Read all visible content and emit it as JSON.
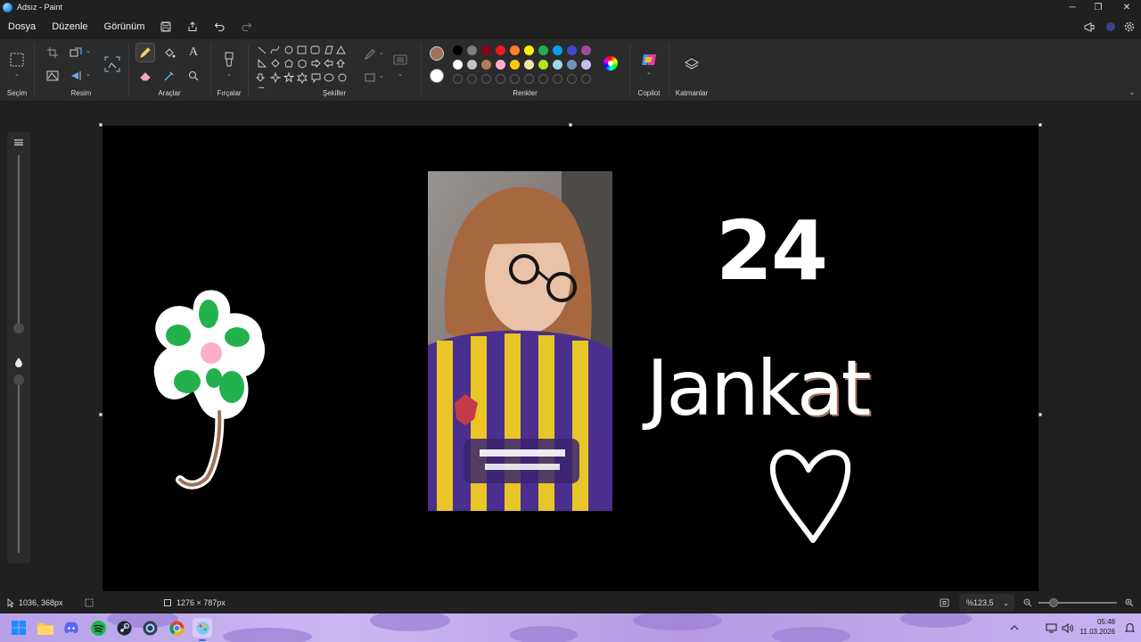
{
  "window": {
    "title": "Adsız - Paint",
    "minimize_glyph": "─",
    "restore_glyph": "❐",
    "close_glyph": "✕"
  },
  "menu": {
    "items": [
      "Dosya",
      "Düzenle",
      "Görünüm"
    ]
  },
  "ribbon": {
    "groups": {
      "selection": "Seçim",
      "image": "Resim",
      "tools": "Araçlar",
      "brushes": "Fırçalar",
      "shapes": "Şekiller",
      "colors": "Renkler",
      "copilot": "Copilot",
      "layers": "Katmanlar"
    },
    "text_tool_glyph": "A",
    "colors": {
      "primary": "#a0705a",
      "secondary": "#ffffff",
      "row1": [
        "#000000",
        "#7f7f7f",
        "#880015",
        "#ed1c24",
        "#ff7f27",
        "#fff200",
        "#22b14c",
        "#00a2e8",
        "#3f48cc",
        "#a349a4"
      ],
      "row2": [
        "#ffffff",
        "#c3c3c3",
        "#b97a57",
        "#ffaec9",
        "#ffc90e",
        "#efe4b0",
        "#b5e61d",
        "#99d9ea",
        "#7092be",
        "#c8bfe7"
      ]
    }
  },
  "canvas": {
    "background": "#000000",
    "text_24": "24",
    "text_jankat": "Jank",
    "text_at": "at",
    "accent_brown": "#a0705a",
    "flower_green": "#22b14c",
    "flower_pink": "#ffaec9"
  },
  "status": {
    "cursor_position": "1036, 368px",
    "canvas_size": "1276 × 787px",
    "zoom": "%123,5"
  },
  "taskbar": {
    "time": "05:48",
    "date": "11.03.2026"
  }
}
